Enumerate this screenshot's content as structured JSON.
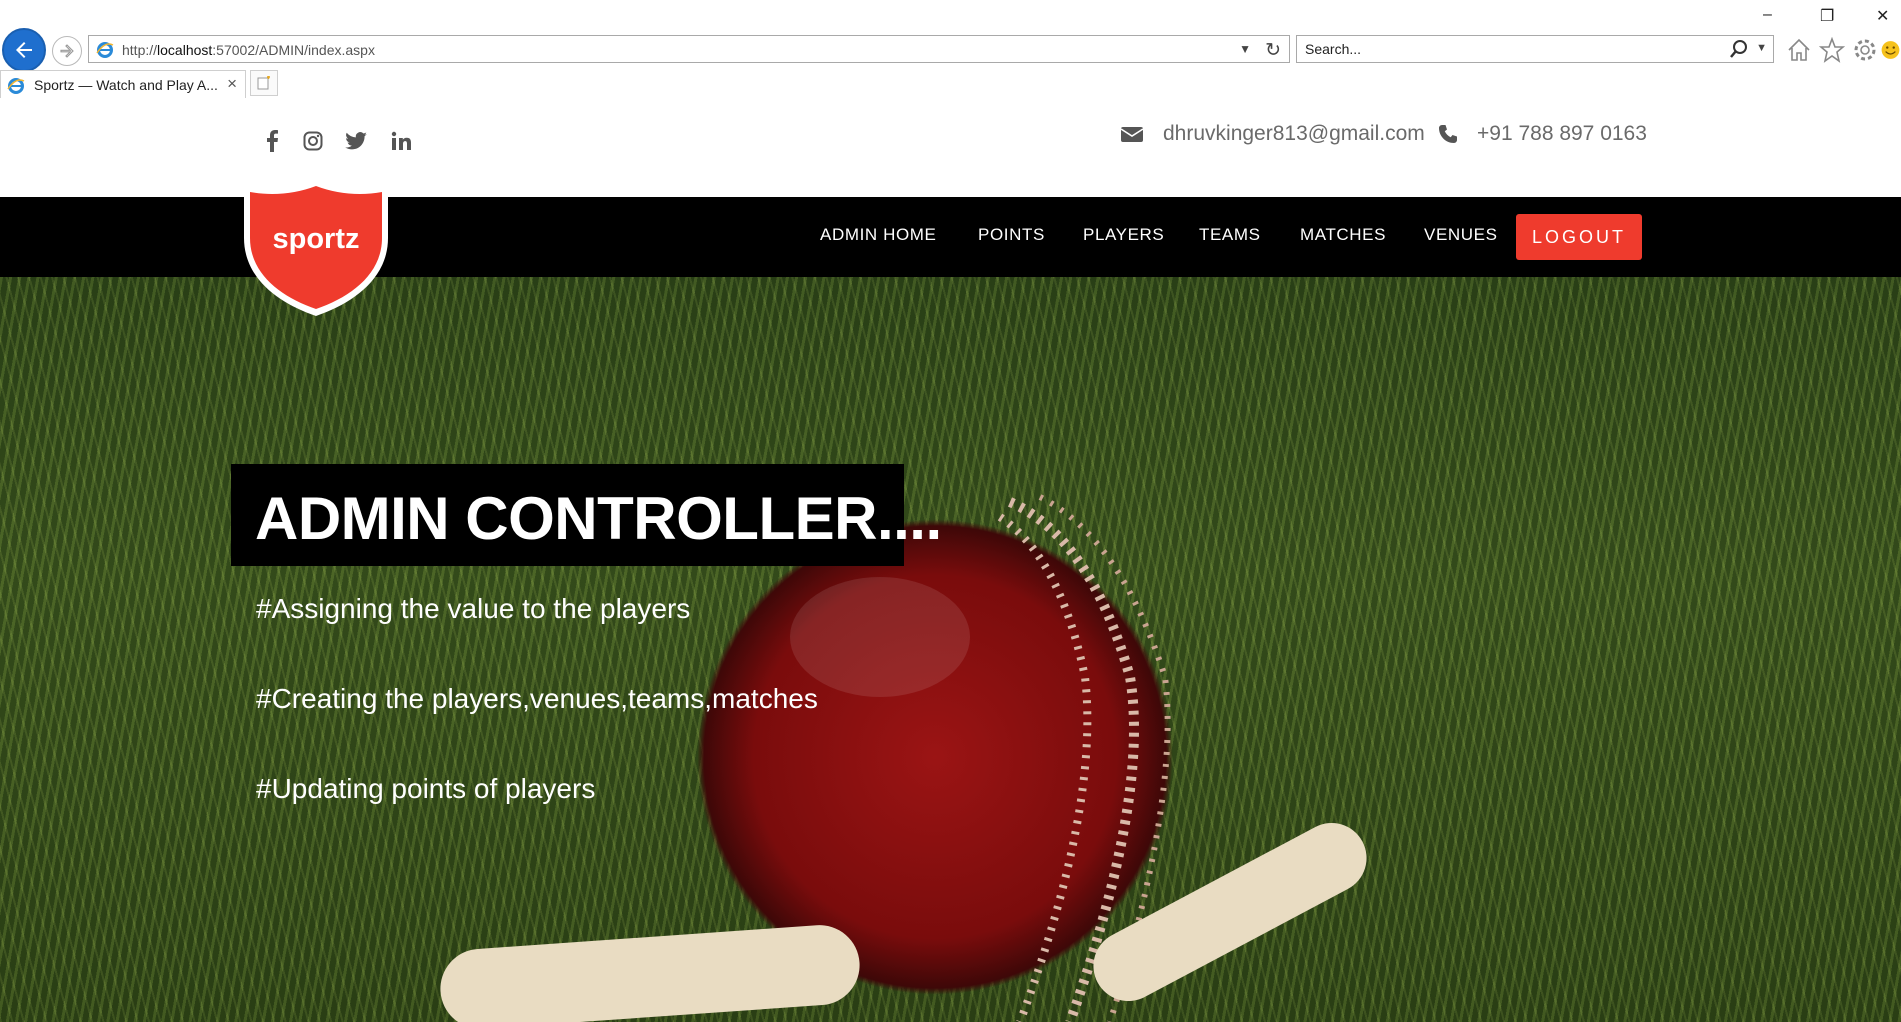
{
  "browser": {
    "url_prefix": "http://",
    "url_host": "localhost",
    "url_rest": ":57002/ADMIN/index.aspx",
    "search_placeholder": "Search...",
    "tab_title": "Sportz — Watch and Play A...",
    "window_controls": {
      "minimize": "–",
      "restore": "❐",
      "close": "✕"
    },
    "toolbar_icons": [
      "home-icon",
      "favorites-star-icon",
      "settings-gear-icon",
      "feedback-smiley-icon"
    ]
  },
  "contact": {
    "email": "dhruvkinger813@gmail.com",
    "phone": "+91 788 897 0163"
  },
  "social": [
    "facebook-icon",
    "instagram-icon",
    "twitter-icon",
    "linkedin-icon"
  ],
  "logo": {
    "text": "sportz",
    "color": "#ef3b2d"
  },
  "nav": {
    "items": [
      "ADMIN HOME",
      "POINTS",
      "PLAYERS",
      "TEAMS",
      "MATCHES",
      "VENUES"
    ],
    "logout_label": "LOGOUT"
  },
  "hero": {
    "headline": "ADMIN CONTROLLER....",
    "bullets": [
      "#Assigning the value to the players",
      "#Creating the players,venues,teams,matches",
      "#Updating points of players"
    ]
  },
  "colors": {
    "accent": "#ef3b2d",
    "navbar": "#000000",
    "ie_blue": "#1f6fce"
  }
}
